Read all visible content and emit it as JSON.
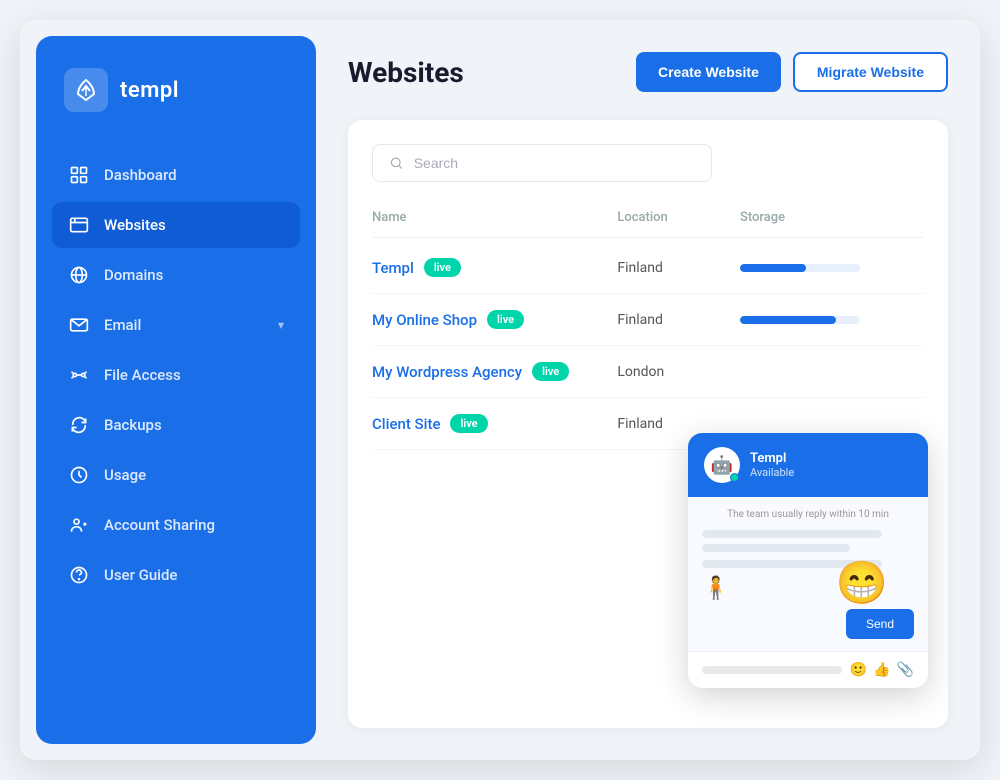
{
  "app": {
    "name": "templ",
    "logo_symbol": "⌂"
  },
  "sidebar": {
    "items": [
      {
        "id": "dashboard",
        "label": "Dashboard",
        "icon": "dashboard-icon",
        "active": false
      },
      {
        "id": "websites",
        "label": "Websites",
        "icon": "websites-icon",
        "active": true
      },
      {
        "id": "domains",
        "label": "Domains",
        "icon": "domains-icon",
        "active": false
      },
      {
        "id": "email",
        "label": "Email",
        "icon": "email-icon",
        "active": false,
        "has_chevron": true
      },
      {
        "id": "file-access",
        "label": "File Access",
        "icon": "file-access-icon",
        "active": false
      },
      {
        "id": "backups",
        "label": "Backups",
        "icon": "backups-icon",
        "active": false
      },
      {
        "id": "usage",
        "label": "Usage",
        "icon": "usage-icon",
        "active": false
      },
      {
        "id": "account-sharing",
        "label": "Account Sharing",
        "icon": "account-sharing-icon",
        "active": false
      },
      {
        "id": "user-guide",
        "label": "User Guide",
        "icon": "user-guide-icon",
        "active": false
      }
    ]
  },
  "header": {
    "page_title": "Websites",
    "create_button": "Create Website",
    "migrate_button": "Migrate Website"
  },
  "search": {
    "placeholder": "Search"
  },
  "table": {
    "columns": [
      "Name",
      "Location",
      "Storage"
    ],
    "rows": [
      {
        "name": "Templ",
        "badge": "live",
        "location": "Finland",
        "storage_pct": 55
      },
      {
        "name": "My Online Shop",
        "badge": "live",
        "location": "Finland",
        "storage_pct": 80
      },
      {
        "name": "My Wordpress Agency",
        "badge": "live",
        "location": "London",
        "storage_pct": 0
      },
      {
        "name": "Client Site",
        "badge": "live",
        "location": "Finland",
        "storage_pct": 0
      }
    ]
  },
  "chat": {
    "agent_name": "Templ",
    "agent_status": "Available",
    "reply_time_notice": "The team usually reply within 10 min",
    "send_button": "Send",
    "emoji": "😁"
  }
}
